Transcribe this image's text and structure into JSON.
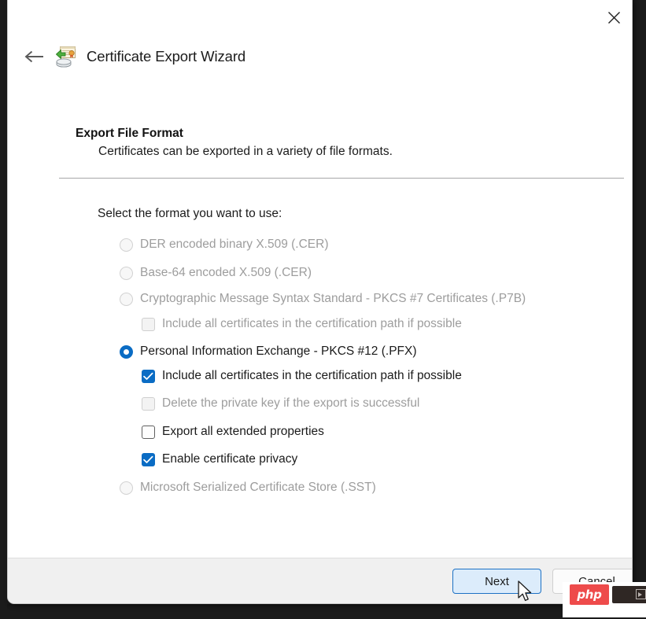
{
  "window": {
    "title": "Certificate Export Wizard",
    "icon": "certificate-export-icon",
    "close_label": "×",
    "back_label": "←"
  },
  "page": {
    "heading": "Export File Format",
    "subheading": "Certificates can be exported in a variety of file formats.",
    "prompt": "Select the format you want to use:"
  },
  "options": [
    {
      "type": "radio",
      "label": "DER encoded binary X.509 (.CER)",
      "checked": false,
      "disabled": true,
      "indent": 0
    },
    {
      "type": "radio",
      "label": "Base-64 encoded X.509 (.CER)",
      "checked": false,
      "disabled": true,
      "indent": 0
    },
    {
      "type": "radio",
      "label": "Cryptographic Message Syntax Standard - PKCS #7 Certificates (.P7B)",
      "checked": false,
      "disabled": true,
      "indent": 0
    },
    {
      "type": "checkbox",
      "label": "Include all certificates in the certification path if possible",
      "checked": false,
      "disabled": true,
      "indent": 1
    },
    {
      "type": "radio",
      "label": "Personal Information Exchange - PKCS #12 (.PFX)",
      "checked": true,
      "disabled": false,
      "indent": 0
    },
    {
      "type": "checkbox",
      "label": "Include all certificates in the certification path if possible",
      "checked": true,
      "disabled": false,
      "indent": 1
    },
    {
      "type": "checkbox",
      "label": "Delete the private key if the export is successful",
      "checked": false,
      "disabled": true,
      "indent": 1
    },
    {
      "type": "checkbox",
      "label": "Export all extended properties",
      "checked": false,
      "disabled": false,
      "indent": 1
    },
    {
      "type": "checkbox",
      "label": "Enable certificate privacy",
      "checked": true,
      "disabled": false,
      "indent": 1
    },
    {
      "type": "radio",
      "label": "Microsoft Serialized Certificate Store (.SST)",
      "checked": false,
      "disabled": true,
      "indent": 0
    }
  ],
  "footer": {
    "next_label": "Next",
    "cancel_label": "Cancel"
  },
  "overlay": {
    "badge_text": "php"
  },
  "colors": {
    "accent": "#0a6cc4",
    "next_button_fill": "#dcecfb",
    "next_button_border": "#1d71c4",
    "footer_bg": "#f0f0f0",
    "disabled_text": "#9d9d9d",
    "text": "#1b1b1b",
    "php_red": "#ee4b4b"
  }
}
